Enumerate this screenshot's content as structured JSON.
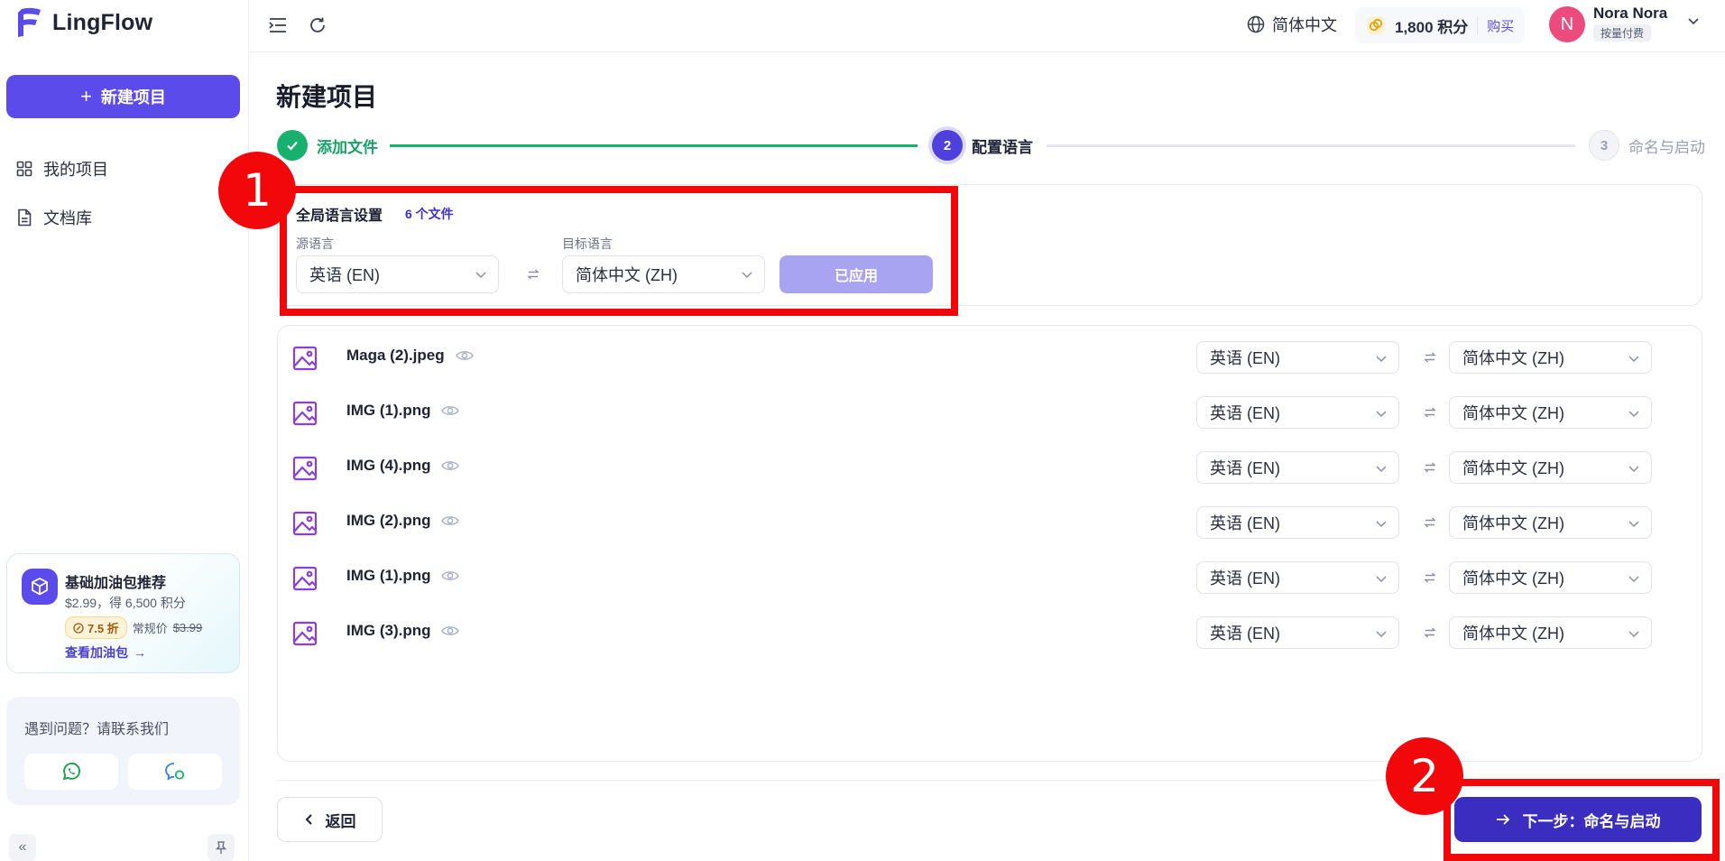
{
  "app": {
    "name": "LingFlow",
    "brand_color": "#5b4bea"
  },
  "sidebar": {
    "new_project_label": "新建项目",
    "nav": [
      {
        "label": "我的项目",
        "icon": "grid-icon"
      },
      {
        "label": "文档库",
        "icon": "document-icon"
      }
    ],
    "promo": {
      "title": "基础加油包推荐",
      "price": "$2.99，得 6,500 积分",
      "discount": "7.5 折",
      "regular_label": "常规价",
      "regular_price": "$3.99",
      "link_label": "查看加油包"
    },
    "help": {
      "title": "遇到问题？请联系我们"
    }
  },
  "topbar": {
    "language": "简体中文",
    "credits": "1,800 积分",
    "buy_label": "购买",
    "user_initial": "N",
    "user_name": "Nora Nora",
    "user_plan": "按量付费"
  },
  "main": {
    "title": "新建项目",
    "steps": [
      {
        "number": "1",
        "label": "添加文件",
        "state": "done"
      },
      {
        "number": "2",
        "label": "配置语言",
        "state": "active"
      },
      {
        "number": "3",
        "label": "命名与启动",
        "state": "pending"
      }
    ],
    "global": {
      "title": "全局语言设置",
      "file_count": "6 个文件",
      "source_label": "源语言",
      "source_value": "英语 (EN)",
      "target_label": "目标语言",
      "target_value": "简体中文 (ZH)",
      "applied_label": "已应用"
    },
    "files": [
      {
        "name": "Maga (2).jpeg",
        "source": "英语 (EN)",
        "target": "简体中文 (ZH)"
      },
      {
        "name": "IMG (1).png",
        "source": "英语 (EN)",
        "target": "简体中文 (ZH)"
      },
      {
        "name": "IMG (4).png",
        "source": "英语 (EN)",
        "target": "简体中文 (ZH)"
      },
      {
        "name": "IMG (2).png",
        "source": "英语 (EN)",
        "target": "简体中文 (ZH)"
      },
      {
        "name": "IMG (1).png",
        "source": "英语 (EN)",
        "target": "简体中文 (ZH)"
      },
      {
        "name": "IMG (3).png",
        "source": "英语 (EN)",
        "target": "简体中文 (ZH)"
      }
    ],
    "back_label": "返回",
    "next_label": "下一步：命名与启动"
  },
  "annotations": [
    {
      "label": "1"
    },
    {
      "label": "2"
    }
  ]
}
